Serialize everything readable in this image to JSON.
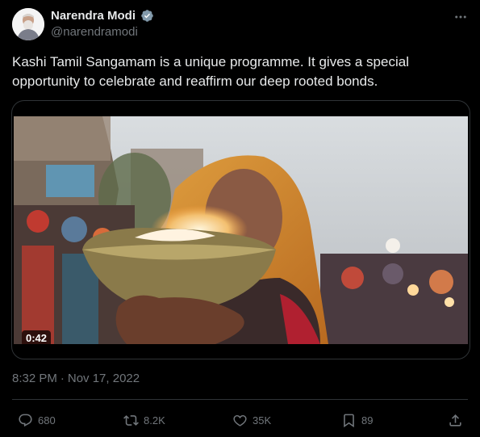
{
  "colors": {
    "background": "#000000",
    "text_primary": "#e7e9ea",
    "text_secondary": "#71767b",
    "verified": "#829aab",
    "border": "#2f3336"
  },
  "author": {
    "name": "Narendra Modi",
    "handle": "@narendramodi",
    "verified_icon": "verified-badge-icon",
    "avatar_icon": "avatar"
  },
  "tweet": {
    "text": "Kashi Tamil Sangamam is a unique programme. It gives a special opportunity to celebrate and reaffirm our deep rooted bonds.",
    "time": "8:32 PM",
    "separator": "·",
    "date": "Nov 17, 2022"
  },
  "media": {
    "type": "video",
    "duration": "0:42"
  },
  "actions": {
    "replies": "680",
    "retweets": "8.2K",
    "likes": "35K",
    "bookmarks": "89",
    "icons": [
      "reply-icon",
      "retweet-icon",
      "like-icon",
      "bookmark-icon",
      "share-icon"
    ]
  },
  "menu": {
    "more_icon": "more-options-icon"
  }
}
